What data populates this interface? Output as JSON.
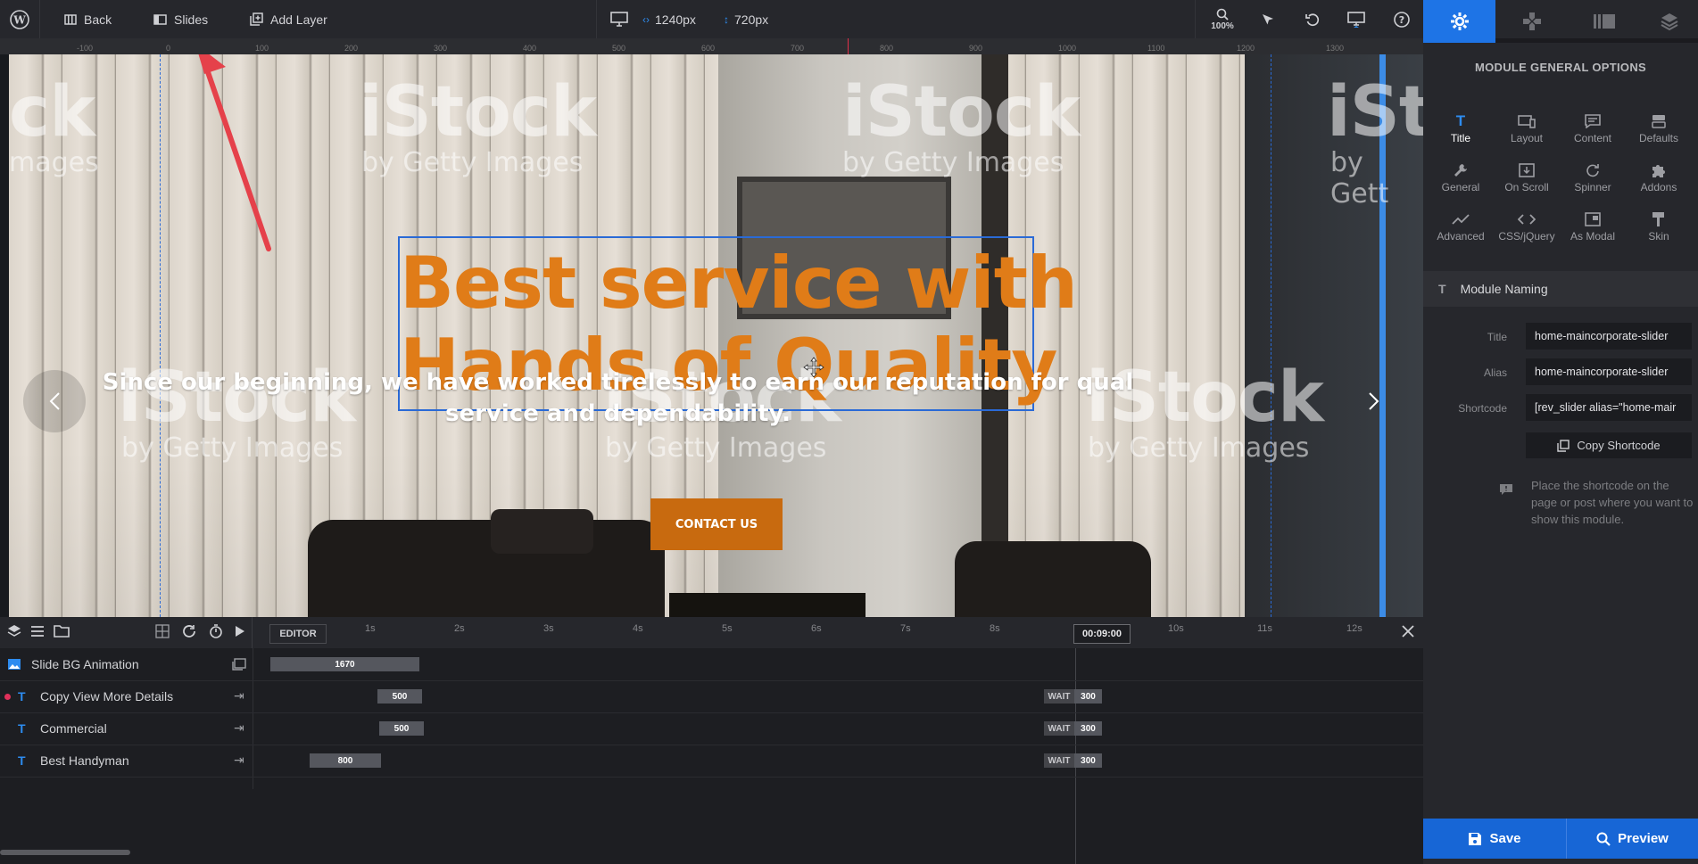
{
  "toolbar": {
    "back_label": "Back",
    "slides_label": "Slides",
    "add_layer_label": "Add Layer",
    "width_value": "1240px",
    "height_value": "720px",
    "zoom_label": "100%"
  },
  "ruler": {
    "ticks": [
      "-100",
      "0",
      "100",
      "200",
      "300",
      "400",
      "500",
      "600",
      "700",
      "800",
      "900",
      "1000",
      "1100",
      "1200",
      "1300"
    ]
  },
  "slide": {
    "headline_line1": "Best service with",
    "headline_line2": "Hands of Quality",
    "subtext_line1": "Since our beginning, we have worked tirelessly to earn our reputation for qual",
    "subtext_line2": "service and dependability.",
    "button_label": "CONTACT US",
    "watermark_brand": "iStock",
    "watermark_sub": "by Getty Images",
    "watermark_frag1": "ck",
    "watermark_frag2": "mages",
    "watermark_frag3": "iSt",
    "watermark_frag4": "by Gett"
  },
  "panel": {
    "title": "MODULE GENERAL OPTIONS",
    "options": [
      {
        "label": "Title",
        "icon": "title-icon"
      },
      {
        "label": "Layout",
        "icon": "layout-icon"
      },
      {
        "label": "Content",
        "icon": "content-icon"
      },
      {
        "label": "Defaults",
        "icon": "defaults-icon"
      },
      {
        "label": "General",
        "icon": "wrench-icon"
      },
      {
        "label": "On Scroll",
        "icon": "scroll-icon"
      },
      {
        "label": "Spinner",
        "icon": "spinner-icon"
      },
      {
        "label": "Addons",
        "icon": "puzzle-icon"
      },
      {
        "label": "Advanced",
        "icon": "chart-icon"
      },
      {
        "label": "CSS/jQuery",
        "icon": "code-icon"
      },
      {
        "label": "As Modal",
        "icon": "modal-icon"
      },
      {
        "label": "Skin",
        "icon": "brush-icon"
      }
    ],
    "section_title": "Module Naming",
    "fields": {
      "title_label": "Title",
      "title_value": "home-maincorporate-slider",
      "alias_label": "Alias",
      "alias_value": "home-maincorporate-slider",
      "shortcode_label": "Shortcode",
      "shortcode_value": "[rev_slider alias=\"home-mair"
    },
    "copy_label": "Copy Shortcode",
    "hint": "Place the shortcode on the page or post where you want to show this module.",
    "save_label": "Save",
    "preview_label": "Preview"
  },
  "timeline": {
    "editor_label": "EDITOR",
    "seconds": [
      "1s",
      "2s",
      "3s",
      "4s",
      "5s",
      "6s",
      "7s",
      "8s",
      "10s",
      "11s",
      "12s"
    ],
    "time_display": "00:09:00",
    "rows": [
      {
        "name": "Slide BG Animation",
        "bar": "1670",
        "wait": "",
        "wait_value": ""
      },
      {
        "name": "Copy View More Details",
        "bar": "500",
        "wait": "WAIT",
        "wait_value": "300"
      },
      {
        "name": "Commercial",
        "bar": "500",
        "wait": "WAIT",
        "wait_value": "300"
      },
      {
        "name": "Best Handyman",
        "bar": "800",
        "wait": "WAIT",
        "wait_value": "300"
      }
    ]
  },
  "colors": {
    "accent_blue": "#1766d6",
    "headline_orange": "#e07c18",
    "button_orange": "#c86a0f"
  }
}
